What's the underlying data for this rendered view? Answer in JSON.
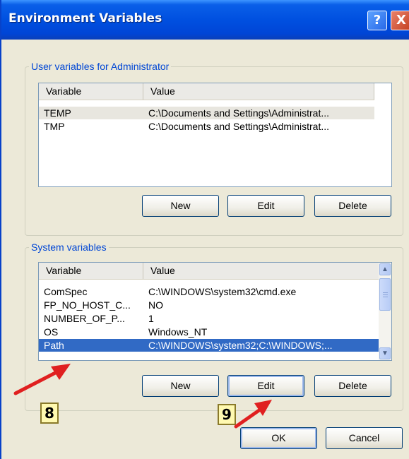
{
  "window": {
    "title": "Environment Variables",
    "help_glyph": "?",
    "close_glyph": "X"
  },
  "user_section": {
    "label": "User variables for Administrator",
    "columns": [
      "Variable",
      "Value"
    ],
    "rows": [
      {
        "variable": "TEMP",
        "value": "C:\\Documents and Settings\\Administrat..."
      },
      {
        "variable": "TMP",
        "value": "C:\\Documents and Settings\\Administrat..."
      }
    ],
    "buttons": {
      "new": "New",
      "edit": "Edit",
      "delete": "Delete"
    }
  },
  "system_section": {
    "label": "System variables",
    "columns": [
      "Variable",
      "Value"
    ],
    "rows": [
      {
        "variable": "ComSpec",
        "value": "C:\\WINDOWS\\system32\\cmd.exe"
      },
      {
        "variable": "FP_NO_HOST_C...",
        "value": "NO"
      },
      {
        "variable": "NUMBER_OF_P...",
        "value": "1"
      },
      {
        "variable": "OS",
        "value": "Windows_NT"
      },
      {
        "variable": "Path",
        "value": "C:\\WINDOWS\\system32;C:\\WINDOWS;..."
      }
    ],
    "selected_row": "Path",
    "buttons": {
      "new": "New",
      "edit": "Edit",
      "delete": "Delete"
    }
  },
  "dialog_buttons": {
    "ok": "OK",
    "cancel": "Cancel"
  },
  "annotations": {
    "step_8": "8",
    "step_9": "9"
  },
  "icons": {
    "scroll_up": "▲",
    "scroll_down": "▼"
  },
  "colors": {
    "titlebar": "#0050E0",
    "selection": "#316AC5",
    "group_label": "#0046D5",
    "arrow": "#E02020",
    "callout_bg": "#FFF9B0"
  }
}
